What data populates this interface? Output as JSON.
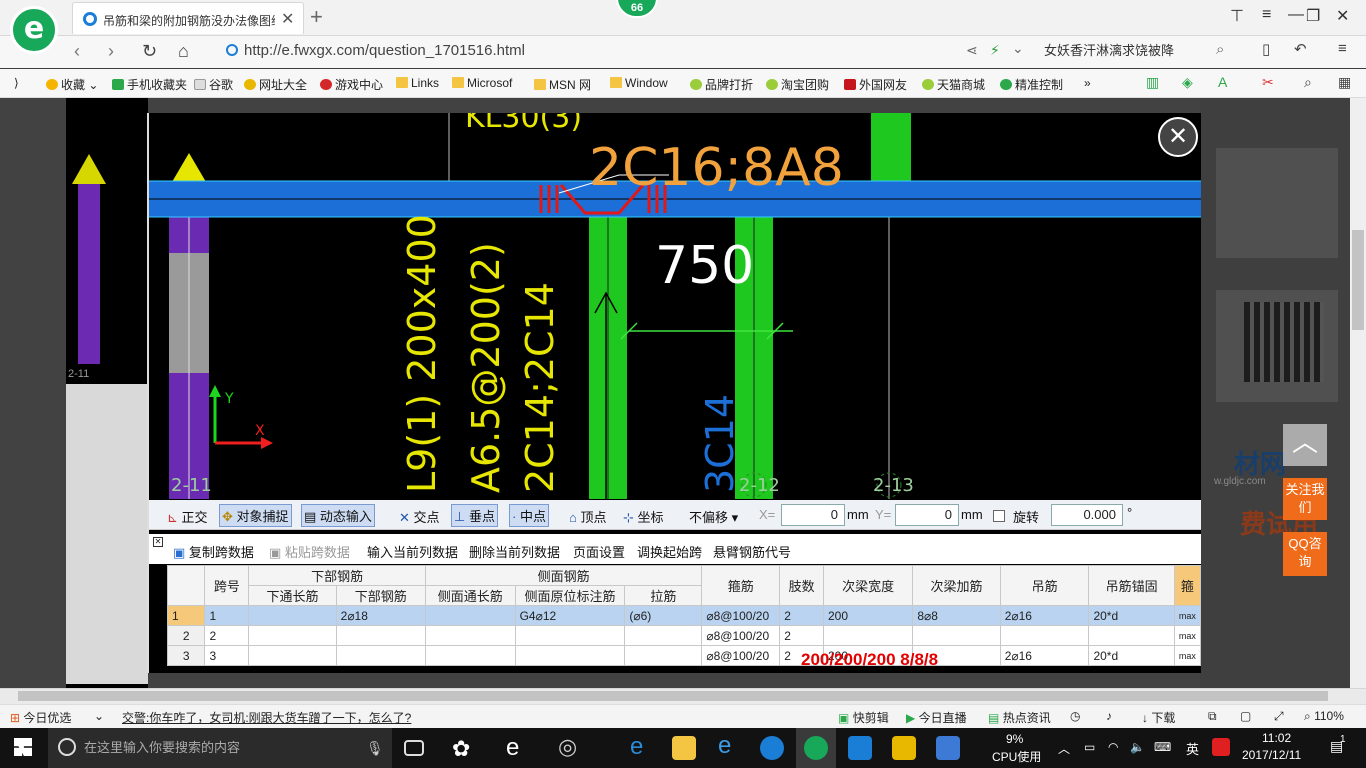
{
  "browser": {
    "tab_title": "吊筋和梁的附加钢筋没办法像图纸",
    "badge": "66",
    "url": "http://e.fwxgx.com/question_1701516.html",
    "search_text": "女妖香汗淋漓求饶被降",
    "bookmarks": [
      "收藏",
      "手机收藏夹",
      "谷歌",
      "网址大全",
      "游戏中心",
      "Links",
      "Microsof",
      "MSN 网",
      "Window",
      "品牌打折",
      "淘宝团购",
      "外国网友",
      "天猫商城",
      "精准控制"
    ]
  },
  "cad": {
    "beam_label_top": "KL30(3)",
    "main_annot": "2C16;8A8",
    "dim": "750",
    "vertical_1": "L9(1) 200x400",
    "vertical_2": "A6.5@200(2)",
    "vertical_3": "2C14;2C14",
    "vertical_4": "3C14",
    "axis_left": "2-11",
    "axis_mid": "2-12",
    "axis_right": "2-13",
    "left_axis_tag": "2-11",
    "axis_y": "Y",
    "axis_x": "X"
  },
  "snapbar": {
    "ortho": "正交",
    "snap": "对象捕捉",
    "dyn": "动态输入",
    "intersect": "交点",
    "perp": "垂点",
    "mid": "中点",
    "vertex": "顶点",
    "coord": "坐标",
    "offset": "不偏移",
    "x_label": "X=",
    "x_val": "0",
    "y_label": "Y=",
    "y_val": "0",
    "unit": "mm",
    "rotate": "旋转",
    "rot_val": "0.000",
    "deg": "°"
  },
  "cmdbar": [
    "复制跨数据",
    "粘贴跨数据",
    "输入当前列数据",
    "删除当前列数据",
    "页面设置",
    "调换起始跨",
    "悬臂钢筋代号"
  ],
  "grid": {
    "group_headers": {
      "bottom": "下部钢筋",
      "side": "侧面钢筋"
    },
    "headers": [
      "跨号",
      "下通长筋",
      "下部钢筋",
      "侧面通长筋",
      "侧面原位标注筋",
      "拉筋",
      "箍筋",
      "肢数",
      "次梁宽度",
      "次梁加筋",
      "吊筋",
      "吊筋锚固",
      "箍"
    ],
    "rows": [
      [
        "1",
        "1",
        "",
        "2⌀18",
        "",
        "G4⌀12",
        "(⌀6)",
        "⌀8@100/20",
        "2",
        "200",
        "8⌀8",
        "2⌀16",
        "20*d",
        "max"
      ],
      [
        "2",
        "2",
        "",
        "",
        "",
        "",
        "",
        "⌀8@100/20",
        "2",
        "",
        "",
        "",
        "",
        "max"
      ],
      [
        "3",
        "3",
        "",
        "",
        "",
        "",
        "",
        "⌀8@100/20",
        "2",
        "200",
        "",
        "2⌀16",
        "20*d",
        "max"
      ]
    ],
    "overlay": "200/200/200  8/8/8"
  },
  "side": {
    "float_top": "︿",
    "follow": "关注我们",
    "qq": "QQ咨询",
    "ad_text": "材网",
    "ad_sub": "w.gldjc.com",
    "ad_red": "费试用"
  },
  "status": {
    "today": "今日优选",
    "news": "交警:你车咋了，女司机:刚跟大货车蹭了一下，怎么了?",
    "kuaijianji": "快剪辑",
    "live": "今日直播",
    "hot": "热点资讯",
    "download": "下载",
    "zoom": "110%"
  },
  "taskbar": {
    "search": "在这里输入你要搜索的内容",
    "cpu": "9%",
    "cpu_label": "CPU使用",
    "ime": "英",
    "time": "11:02",
    "date": "2017/12/11",
    "notif": "1"
  }
}
